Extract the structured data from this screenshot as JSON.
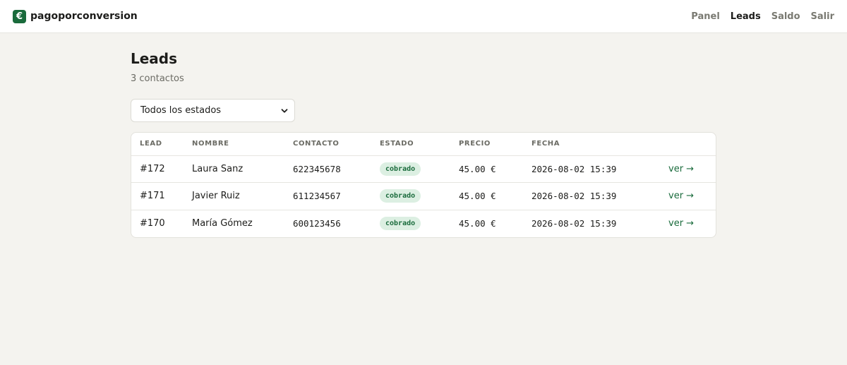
{
  "app": {
    "brand_icon": "€",
    "brand_name": "pagoporconversion",
    "accent_color": "#1a6b3c"
  },
  "nav": {
    "items": [
      {
        "label": "Panel",
        "active": false
      },
      {
        "label": "Leads",
        "active": true
      },
      {
        "label": "Saldo",
        "active": false
      },
      {
        "label": "Salir",
        "active": false
      }
    ]
  },
  "page": {
    "title": "Leads",
    "subtitle": "3 contactos"
  },
  "filter": {
    "selected": "Todos los estados",
    "icon": "chevron-down-icon"
  },
  "table": {
    "headers": [
      "LEAD",
      "NOMBRE",
      "CONTACTO",
      "ESTADO",
      "PRECIO",
      "FECHA",
      ""
    ],
    "rows": [
      {
        "lead": "#172",
        "name": "Laura Sanz",
        "contact": "622345678",
        "status": "cobrado",
        "price": "45.00 €",
        "date": "2026-08-02 15:39",
        "action": "ver →"
      },
      {
        "lead": "#171",
        "name": "Javier Ruiz",
        "contact": "611234567",
        "status": "cobrado",
        "price": "45.00 €",
        "date": "2026-08-02 15:39",
        "action": "ver →"
      },
      {
        "lead": "#170",
        "name": "María Gómez",
        "contact": "600123456",
        "status": "cobrado",
        "price": "45.00 €",
        "date": "2026-08-02 15:39",
        "action": "ver →"
      }
    ]
  }
}
